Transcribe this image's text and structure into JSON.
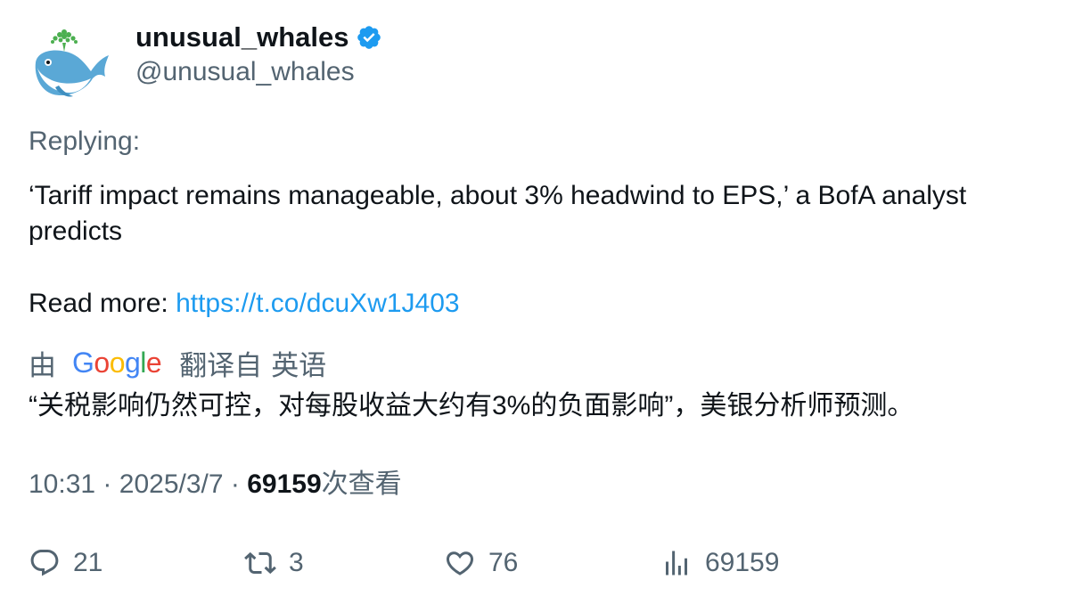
{
  "author": {
    "display_name": "unusual_whales",
    "handle": "@unusual_whales",
    "verified_icon": "verified-badge-icon",
    "avatar_icon": "whale-avatar-icon"
  },
  "replying_label": "Replying:",
  "tweet": {
    "text": "‘Tariff impact remains manageable, about 3% headwind to EPS,’ a BofA analyst predicts",
    "read_more_label": "Read more: ",
    "link": "https://t.co/dcuXw1J403"
  },
  "translation": {
    "by_label": "由",
    "provider": "Google",
    "translated_from_label": "翻译自",
    "language": "英语",
    "text": "“关税影响仍然可控，对每股收益大约有3%的负面影响”，美银分析师预测。"
  },
  "meta": {
    "time": "10:31",
    "separator": "·",
    "date": "2025/3/7",
    "views_count": "69159",
    "views_label": "次查看"
  },
  "actions": {
    "reply_count": "21",
    "retweet_count": "3",
    "like_count": "76",
    "views_count": "69159"
  },
  "colors": {
    "link": "#1d9bf0",
    "secondary_text": "#536471",
    "primary_text": "#0f1419",
    "verified": "#1d9bf0"
  }
}
